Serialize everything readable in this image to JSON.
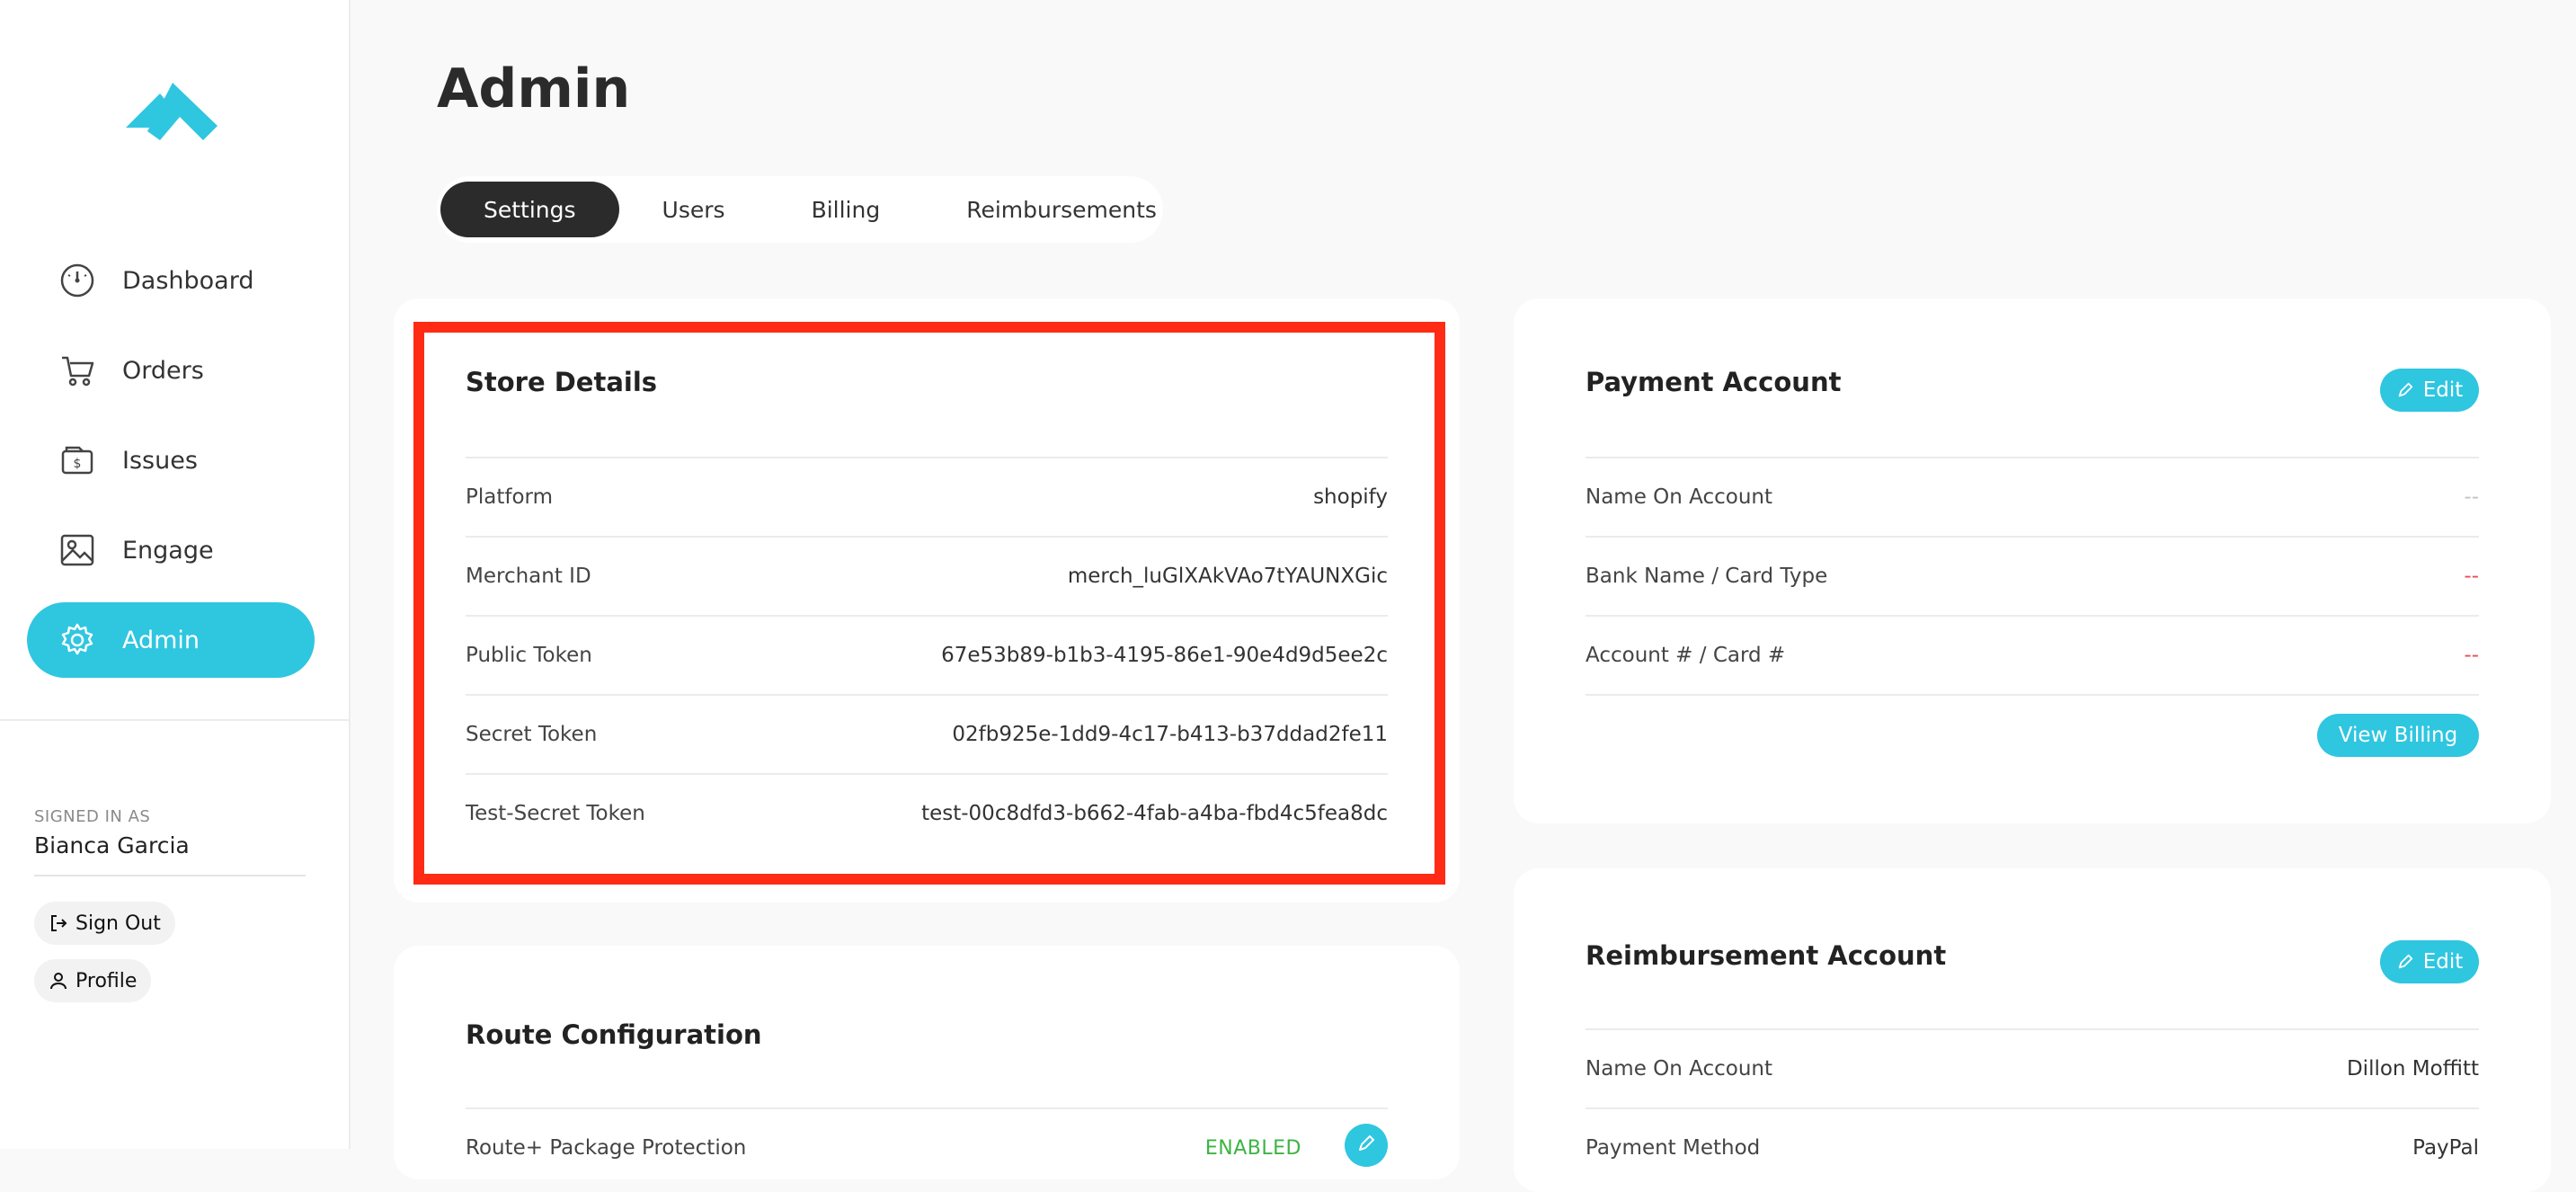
{
  "sidebar": {
    "nav": [
      {
        "label": "Dashboard",
        "icon": "dashboard-gauge-icon"
      },
      {
        "label": "Orders",
        "icon": "cart-icon"
      },
      {
        "label": "Issues",
        "icon": "folder-dollar-icon"
      },
      {
        "label": "Engage",
        "icon": "image-icon"
      },
      {
        "label": "Admin",
        "icon": "gear-icon"
      }
    ],
    "active_item": "Admin",
    "signed_in_label": "SIGNED IN AS",
    "user_name": "Bianca Garcia",
    "sign_out_label": "Sign Out",
    "profile_label": "Profile"
  },
  "main": {
    "title": "Admin",
    "tabs": [
      "Settings",
      "Users",
      "Billing",
      "Reimbursements"
    ],
    "active_tab": "Settings"
  },
  "store_details": {
    "title": "Store Details",
    "rows": [
      {
        "label": "Platform",
        "value": "shopify"
      },
      {
        "label": "Merchant ID",
        "value": "merch_luGlXAkVAo7tYAUNXGic"
      },
      {
        "label": "Public Token",
        "value": "67e53b89-b1b3-4195-86e1-90e4d9d5ee2c"
      },
      {
        "label": "Secret Token",
        "value": "02fb925e-1dd9-4c17-b413-b37ddad2fe11"
      },
      {
        "label": "Test-Secret Token",
        "value": "test-00c8dfd3-b662-4fab-a4ba-fbd4c5fea8dc"
      }
    ]
  },
  "route_config": {
    "title": "Route Configuration",
    "rows": [
      {
        "label": "Route+ Package Protection",
        "value": "ENABLED"
      }
    ]
  },
  "payment_account": {
    "title": "Payment Account",
    "edit_label": "Edit",
    "rows": [
      {
        "label": "Name On Account",
        "value": "--"
      },
      {
        "label": "Bank Name / Card Type",
        "value": "--"
      },
      {
        "label": "Account # / Card #",
        "value": "--"
      }
    ],
    "view_billing_label": "View Billing"
  },
  "reimbursement_account": {
    "title": "Reimbursement Account",
    "edit_label": "Edit",
    "rows": [
      {
        "label": "Name On Account",
        "value": "Dillon Moffitt"
      },
      {
        "label": "Payment Method",
        "value": "PayPal"
      }
    ]
  },
  "colors": {
    "accent": "#2fc6e0",
    "highlight": "#ff2b14",
    "dash_red": "#e84b5a",
    "enabled_green": "#3cb443",
    "dark": "#2b2b2b"
  }
}
